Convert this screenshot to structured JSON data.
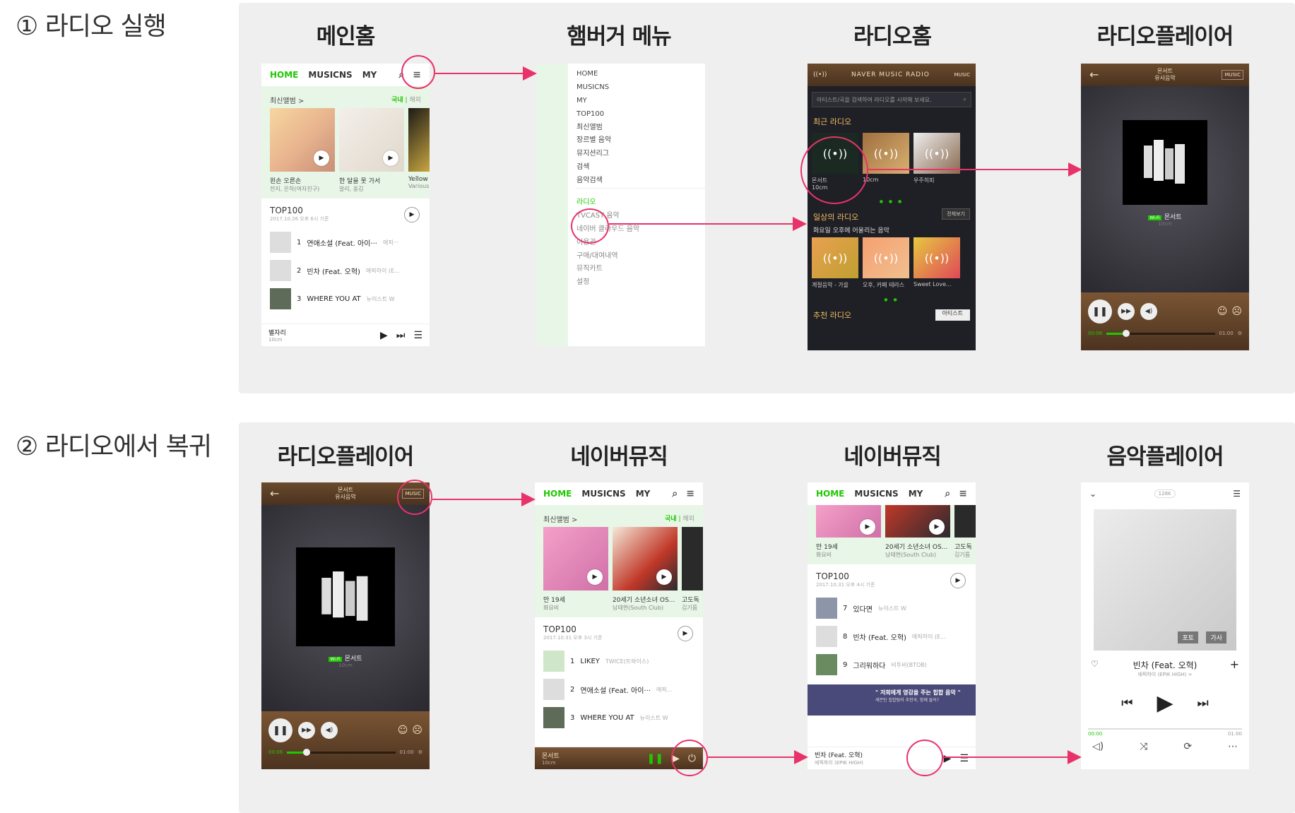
{
  "steps": {
    "step1_label": "① 라디오 실행",
    "step2_label": "② 라디오에서 복귀"
  },
  "row1_titles": [
    "메인홈",
    "햄버거 메뉴",
    "라디오홈",
    "라디오플레이어"
  ],
  "row2_titles": [
    "라디오플레이어",
    "네이버뮤직",
    "네이버뮤직",
    "음악플레이어"
  ],
  "naver_main": {
    "tabs": {
      "home": "HOME",
      "musicns": "MUSICNS",
      "my": "MY"
    },
    "latest_album": "최신앨범 >",
    "domestic": "국내",
    "overseas": "해외",
    "albums": [
      {
        "title": "왼손 오른손",
        "artist": "전지, 은하(여자친구)"
      },
      {
        "title": "한 달을 못 가서",
        "artist": "알리, 옹김"
      },
      {
        "title": "Yellow",
        "artist": "Various"
      }
    ],
    "top100": "TOP100",
    "top100_date": "2017.10.26 오후 6시 기준",
    "rows": [
      {
        "rank": "1",
        "title": "연애소설 (Feat. 아이···",
        "artist": "에픽···"
      },
      {
        "rank": "2",
        "title": "빈차 (Feat. 오혁)",
        "artist": "에픽하이 (E..."
      },
      {
        "rank": "3",
        "title": "WHERE YOU AT",
        "artist": "뉴이스트 W"
      }
    ],
    "now_playing": "별자리",
    "now_playing_artist": "10cm"
  },
  "hamburger": {
    "items": [
      "HOME",
      "MUSICNS",
      "MY",
      "TOP100",
      "최신앨범",
      "장르별 음악",
      "뮤지션리그",
      "검색",
      "음악검색"
    ],
    "radio": "라디오",
    "items2": [
      "TVCAST 음악",
      "네이버 클라우드 음악",
      "이용권",
      "구매/대여내역",
      "뮤직카트",
      "설정"
    ]
  },
  "radio_home": {
    "logo": "NAVER MUSIC RADIO",
    "music_label": "MUSIC",
    "search_placeholder": "아티스트/곡을 검색하여 라디오를 시작해 보세요.",
    "recent_radio": "최근 라디오",
    "recent_cards": [
      "몬서트",
      "10cm",
      "우주히피"
    ],
    "recent_sub": "10cm",
    "daily_radio": "일상의 라디오",
    "see_all": "전체보기",
    "daily_sub": "화요일 오후에 어울리는 음악",
    "daily_cards": [
      "계절음악 - 가을",
      "오후, 카페 테라스",
      "Sweet Love..."
    ],
    "recommend": "추천 라디오",
    "recommend_tab": "아티스트"
  },
  "radio_player": {
    "title": "몬서트",
    "subtitle": "유사음악",
    "music_label": "MUSIC",
    "wifi": "Wi-Fi",
    "track": "몬서트",
    "artist": "10cm",
    "time_current": "00:06",
    "time_total": "01:00",
    "progress": 0.18,
    "like": "좋은곡",
    "dislike": "싫은곡"
  },
  "naver_music2": {
    "tabs": {
      "home": "HOME",
      "musicns": "MUSICNS",
      "my": "MY"
    },
    "latest_album": "최신앨범 >",
    "domestic": "국내",
    "overseas": "해외",
    "albums": [
      {
        "title": "만 19세",
        "artist": "화요비"
      },
      {
        "title": "20세기 소년소녀 OS...",
        "artist": "남태현(South Club)"
      },
      {
        "title": "고도독",
        "artist": "김기름"
      }
    ],
    "top100": "TOP100",
    "top100_date": "2017.10.31 오후 3시 기준",
    "rows": [
      {
        "rank": "1",
        "title": "LIKEY",
        "artist": "TWICE(트와이스)"
      },
      {
        "rank": "2",
        "title": "연애소설 (Feat. 아이···",
        "artist": "에픽..."
      },
      {
        "rank": "3",
        "title": "WHERE YOU AT",
        "artist": "뉴이스트 W"
      }
    ],
    "now_playing": "몬서트",
    "now_playing_artist": "10cm"
  },
  "naver_music3": {
    "tabs": {
      "home": "HOME",
      "musicns": "MUSICNS",
      "my": "MY"
    },
    "albums": [
      {
        "title": "만 19세",
        "artist": "화요비"
      },
      {
        "title": "20세기 소년소녀 OS...",
        "artist": "남태현(South Club)"
      },
      {
        "title": "고도독",
        "artist": "김기름"
      }
    ],
    "top100": "TOP100",
    "top100_date": "2017.10.31 오후 4시 기준",
    "rows": [
      {
        "rank": "7",
        "title": "있다면",
        "artist": "뉴이스트 W"
      },
      {
        "rank": "8",
        "title": "빈차 (Feat. 오혁)",
        "artist": "에픽하이 (E..."
      },
      {
        "rank": "9",
        "title": "그리워하다",
        "artist": "비투비(BTOB)"
      }
    ],
    "banner_title": "\" 저희에게 영감을 주는 힙합 음악 \"",
    "banner_sub": "세븐틴 힙합팀의 추천곡, 함께 들어?",
    "now_playing": "빈차 (Feat. 오혁)",
    "now_playing_artist": "에픽하이 (EPIK HIGH)"
  },
  "music_player": {
    "quality": "128K",
    "photo": "포토",
    "lyrics": "가사",
    "title": "빈차 (Feat. 오혁)",
    "artist": "에픽하이 (EPIK HIGH) >",
    "time_current": "00:00",
    "time_total": "01:00"
  },
  "colors": {
    "accent": "#1ec800",
    "highlight": "#e8336a",
    "panel": "#efefef",
    "wood": "#6a4a2c"
  }
}
